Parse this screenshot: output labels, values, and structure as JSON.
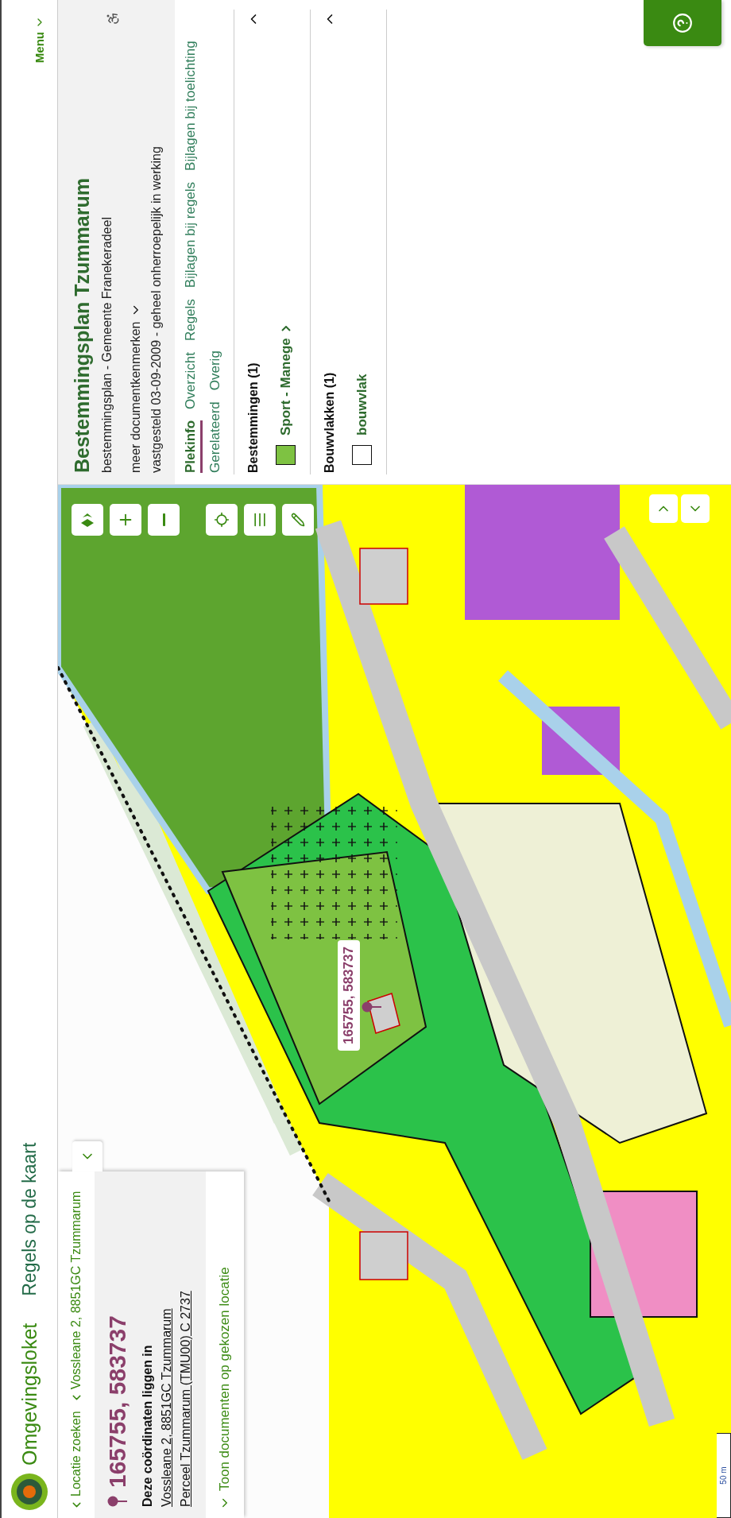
{
  "header": {
    "logo_text": "Omgevingsloket",
    "app_title": "Regels op de kaart",
    "menu": "Menu"
  },
  "location_panel": {
    "breadcrumbs": [
      "Locatie zoeken",
      "Vossleane 2, 8851GC Tzummarum"
    ],
    "coordinates": "165755, 583737",
    "intro": "Deze coördinaten liggen in",
    "links": [
      "Vossleane 2, 8851GC Tzummarum",
      "Perceel Tzummarum (TMU00) C 2737"
    ],
    "show_documents": "Toon documenten op gekozen locatie"
  },
  "map": {
    "coordinate_label": "165755, 583737",
    "scale": "50 m"
  },
  "plan_panel": {
    "title": "Bestemmingsplan Tzummarum",
    "subtitle": "bestemmingsplan - Gemeente Franekeradeel",
    "more": "meer documentkenmerken",
    "status": "vastgesteld 03-09-2009 - geheel onherroepelijk in werking",
    "tabs": [
      {
        "label": "Plekinfo",
        "selected": true
      },
      {
        "label": "Overzicht",
        "selected": false
      },
      {
        "label": "Regels",
        "selected": false
      },
      {
        "label": "Bijlagen bij regels",
        "selected": false
      },
      {
        "label": "Bijlagen bij toelichting",
        "selected": false
      },
      {
        "label": "Gerelateerd",
        "selected": false
      },
      {
        "label": "Overig",
        "selected": false
      }
    ],
    "sections": [
      {
        "title": "Bestemmingen (1)",
        "expanded": true,
        "items": [
          {
            "label": "Sport - Manege",
            "color": "#7ec242"
          }
        ]
      },
      {
        "title": "Bouwvlakken (1)",
        "expanded": true,
        "items": [
          {
            "label": "bouwvlak",
            "color": "#ffffff"
          }
        ]
      }
    ]
  }
}
